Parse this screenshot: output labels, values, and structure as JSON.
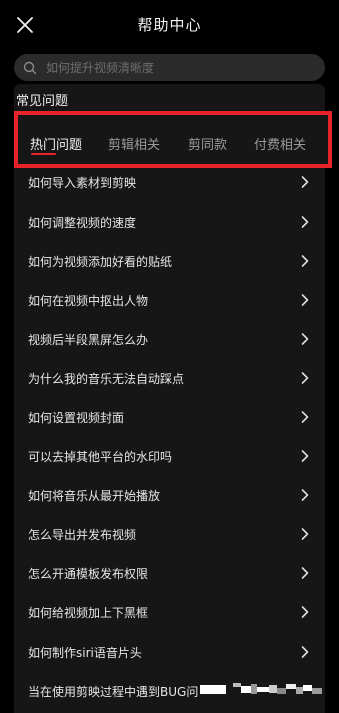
{
  "header": {
    "title": "帮助中心",
    "close_icon": "close-icon"
  },
  "search": {
    "placeholder": "如何提升视频清晰度",
    "icon": "search-icon"
  },
  "section": {
    "title": "常见问题"
  },
  "tabs": [
    {
      "label": "热门问题",
      "active": true
    },
    {
      "label": "剪辑相关",
      "active": false
    },
    {
      "label": "剪同款",
      "active": false
    },
    {
      "label": "付费相关",
      "active": false
    }
  ],
  "items": [
    {
      "label": "如何导入素材到剪映"
    },
    {
      "label": "如何调整视频的速度"
    },
    {
      "label": "如何为视频添加好看的贴纸"
    },
    {
      "label": "如何在视频中抠出人物"
    },
    {
      "label": "视频后半段黑屏怎么办"
    },
    {
      "label": "为什么我的音乐无法自动踩点"
    },
    {
      "label": "如何设置视频封面"
    },
    {
      "label": "可以去掉其他平台的水印吗"
    },
    {
      "label": "如何将音乐从最开始播放"
    },
    {
      "label": "怎么导出并发布视频"
    },
    {
      "label": "怎么开通模板发布权限"
    },
    {
      "label": "如何给视频加上下黑框"
    },
    {
      "label": "如何制作siri语音片头"
    },
    {
      "label": "当在使用剪映过程中遇到BUG问"
    }
  ],
  "colors": {
    "accent": "#e8232b",
    "background": "#000000",
    "panel": "#161616"
  }
}
